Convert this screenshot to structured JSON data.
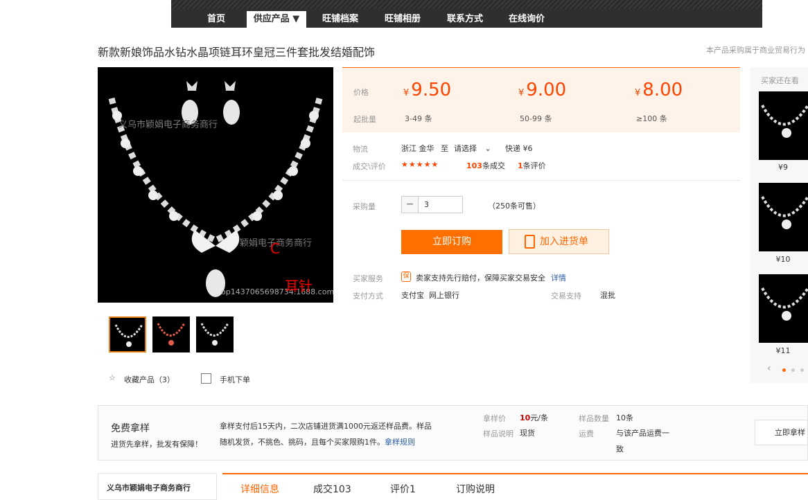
{
  "nav": {
    "items": [
      "首页",
      "供应产品 ▼",
      "旺铺档案",
      "旺铺相册",
      "联系方式",
      "在线询价"
    ]
  },
  "product": {
    "title": "新款新娘饰品水钻水晶项链耳环皇冠三件套批发结婚配饰",
    "note": "本产品采购属于商业贸易行为",
    "image_watermark_1": "义乌市颖娟电子商务商行",
    "image_watermark_2": "颖娟电子商务商行",
    "image_watermark_3": "op1437065698734.1688.com",
    "image_label_c": "C",
    "image_label_earpin": "耳针"
  },
  "pricing": {
    "price_label": "价格",
    "moq_label": "起批量",
    "currency": "¥",
    "tiers": [
      {
        "price": "9.50",
        "qty": "3-49 条"
      },
      {
        "price": "9.00",
        "qty": "50-99 条"
      },
      {
        "price": "8.00",
        "qty": "≥100 条"
      }
    ]
  },
  "logistics": {
    "label": "物流",
    "from": "浙江 金华",
    "to": "至",
    "select": "请选择",
    "express": "快递 ¥6"
  },
  "deals": {
    "label": "成交\\评价",
    "stars": "★★★★★",
    "count": "103",
    "count_unit": "条成交",
    "reviews": "1",
    "reviews_unit": "条评价"
  },
  "purchase": {
    "label": "采购量",
    "minus": "−",
    "value": "3",
    "stock": "（250条可售）",
    "buy_button": "立即订购",
    "cart_button": "加入进货单"
  },
  "services": {
    "label": "买家服务",
    "badge": "保",
    "text": "卖家支持先行赔付，保障买家交易安全",
    "link": "详情",
    "pay_label": "支付方式",
    "pay_methods": "支付宝  网上银行",
    "trade_label": "交易支持",
    "trade_value": "混批"
  },
  "actions": {
    "favorite": "收藏产品（3）",
    "mobile": "手机下单"
  },
  "recommend": {
    "title": "买家还在看",
    "prices": [
      "¥9",
      "¥10",
      "¥11"
    ]
  },
  "sample": {
    "title": "免费拿样",
    "subtitle": "进货先拿样，批发有保障！",
    "desc_line1": "拿样支付后15天内，二次店铺进货满1000元返还样品费。样品",
    "desc_line2": "随机发货，不挑色、挑码，且每个买家限购1件。",
    "rules_link": "拿样规则",
    "sample_price_label": "拿样价",
    "sample_price": "10",
    "sample_price_unit": "元/条",
    "sample_qty_label": "样品数量",
    "sample_qty": "10条",
    "sample_desc_label": "样品说明",
    "sample_desc": "现货",
    "shipping_label": "运费",
    "shipping_line1": "与该产品运费一",
    "shipping_line2": "致",
    "button": "立即拿样"
  },
  "bottom": {
    "shop_name": "义乌市颖娟电子商务商行",
    "tabs": [
      "详细信息",
      "成交103",
      "评价1",
      "订购说明"
    ]
  },
  "colors": {
    "accent": "#ff6f00",
    "price": "#ff4400",
    "nav_bg": "#2f2f2f"
  }
}
